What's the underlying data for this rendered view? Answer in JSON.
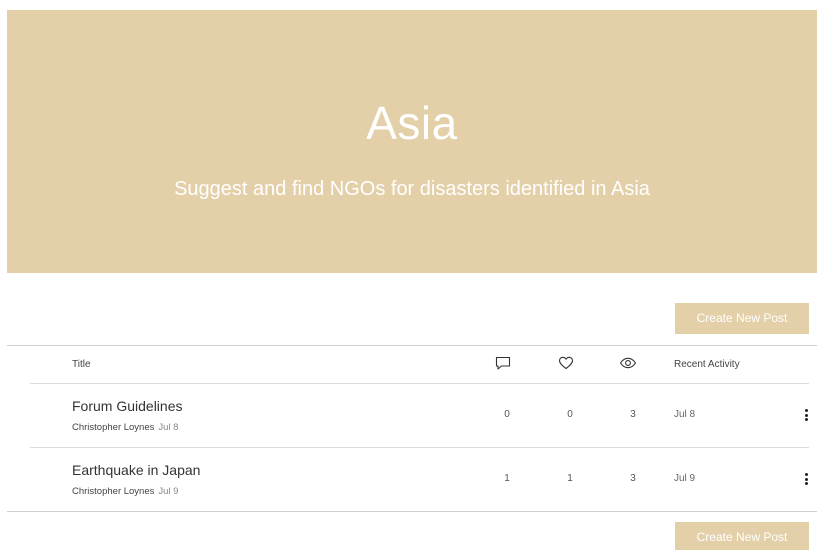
{
  "banner": {
    "title": "Asia",
    "subtitle": "Suggest and find NGOs for disasters identified in Asia",
    "color": "#e3cfa8"
  },
  "actions": {
    "create_post_label": "Create New Post"
  },
  "table": {
    "columns": {
      "title": "Title",
      "comments_icon": "comment-icon",
      "likes_icon": "heart-icon",
      "views_icon": "eye-icon",
      "recent_activity": "Recent Activity"
    },
    "rows": [
      {
        "title": "Forum Guidelines",
        "author": "Christopher Loynes",
        "date": "Jul 8",
        "comments": "0",
        "likes": "0",
        "views": "3",
        "recent_activity": "Jul 8"
      },
      {
        "title": "Earthquake in Japan",
        "author": "Christopher Loynes",
        "date": "Jul 9",
        "comments": "1",
        "likes": "1",
        "views": "3",
        "recent_activity": "Jul 9"
      }
    ]
  }
}
